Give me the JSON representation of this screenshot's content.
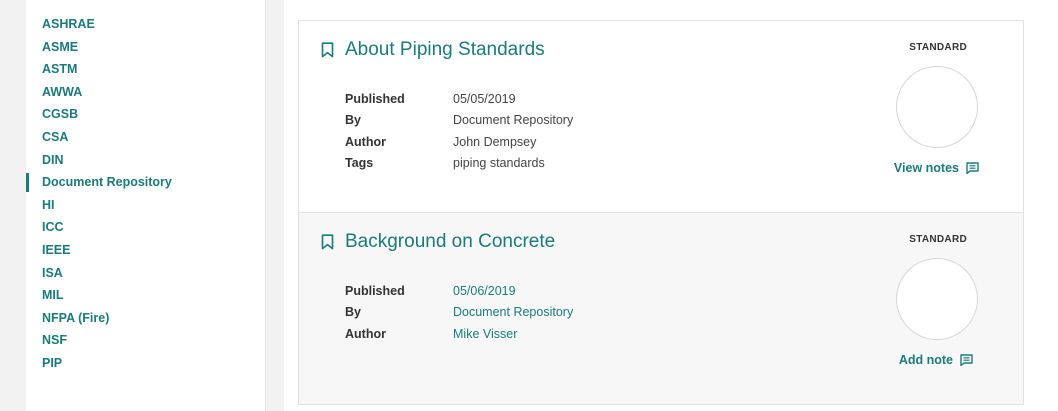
{
  "sidebar": {
    "items": [
      {
        "label": "ASHRAE"
      },
      {
        "label": "ASME"
      },
      {
        "label": "ASTM"
      },
      {
        "label": "AWWA"
      },
      {
        "label": "CGSB"
      },
      {
        "label": "CSA"
      },
      {
        "label": "DIN"
      },
      {
        "label": "Document Repository",
        "active": true
      },
      {
        "label": "HI"
      },
      {
        "label": "ICC"
      },
      {
        "label": "IEEE"
      },
      {
        "label": "ISA"
      },
      {
        "label": "MIL"
      },
      {
        "label": "NFPA (Fire)"
      },
      {
        "label": "NSF"
      },
      {
        "label": "PIP"
      }
    ]
  },
  "results": [
    {
      "title": "About Piping Standards",
      "type": "STANDARD",
      "meta": {
        "published_label": "Published",
        "published_value": "05/05/2019",
        "by_label": "By",
        "by_value": "Document Repository",
        "author_label": "Author",
        "author_value": "John Dempsey",
        "tags_label": "Tags",
        "tags_value": "piping standards"
      },
      "notes_label": "View notes"
    },
    {
      "title": "Background on Concrete",
      "type": "STANDARD",
      "meta": {
        "published_label": "Published",
        "published_value": "05/06/2019",
        "by_label": "By",
        "by_value": "Document Repository",
        "author_label": "Author",
        "author_value": "Mike Visser"
      },
      "notes_label": "Add note"
    }
  ],
  "icons": {
    "bookmark": "bookmark-icon",
    "notes": "notes-icon"
  },
  "colors": {
    "accent": "#1b7a7a",
    "background": "#f2f2f2",
    "card_alt": "#f7f7f7",
    "border": "#e2e2e2"
  }
}
